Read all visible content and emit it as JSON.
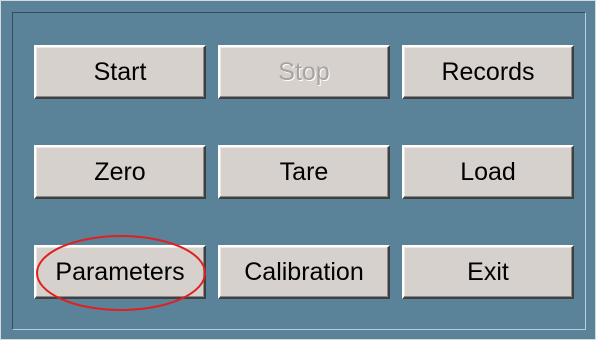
{
  "buttons": {
    "start": "Start",
    "stop": "Stop",
    "records": "Records",
    "zero": "Zero",
    "tare": "Tare",
    "load": "Load",
    "parameters": "Parameters",
    "calibration": "Calibration",
    "exit": "Exit"
  },
  "states": {
    "stop_disabled": true
  },
  "colors": {
    "panel_background": "#5a8399",
    "button_face": "#d6d1cc",
    "disabled_text": "#a8a39e",
    "annotation": "#e02020"
  },
  "annotation": {
    "shape": "ellipse",
    "target": "parameters"
  }
}
